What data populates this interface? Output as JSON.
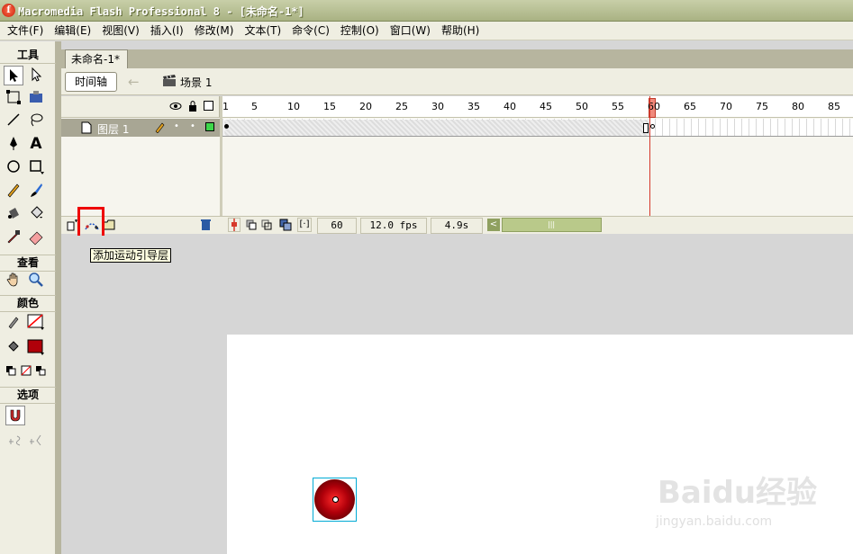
{
  "title_bar": {
    "app_icon_letter": "f",
    "title": "Macromedia Flash Professional 8 - [未命名-1*]"
  },
  "menu": [
    "文件(F)",
    "编辑(E)",
    "视图(V)",
    "插入(I)",
    "修改(M)",
    "文本(T)",
    "命令(C)",
    "控制(O)",
    "窗口(W)",
    "帮助(H)"
  ],
  "tools_panel": {
    "header_tools": "工具",
    "header_view": "查看",
    "header_colors": "颜色",
    "header_options": "选项"
  },
  "document": {
    "tab_label": "未命名-1*",
    "timeline_button": "时间轴",
    "scene_label": "场景 1"
  },
  "timeline": {
    "layer_name": "图层 1",
    "ruler_labels": [
      "1",
      "5",
      "10",
      "15",
      "20",
      "25",
      "30",
      "35",
      "40",
      "45",
      "50",
      "55",
      "60",
      "65",
      "70",
      "75",
      "80",
      "85"
    ],
    "current_frame": "60",
    "fps": "12.0 fps",
    "elapsed": "4.9s",
    "tooltip": "添加运动引导层"
  },
  "watermark": {
    "brand": "Baidu经验",
    "url": "jingyan.baidu.com"
  },
  "colors": {
    "title_bar": "#a9b283",
    "panel_bg": "#efeee2",
    "playhead": "#d6382a",
    "stroke_swatch": "#ff0000",
    "fill_swatch": "#b0000a"
  }
}
